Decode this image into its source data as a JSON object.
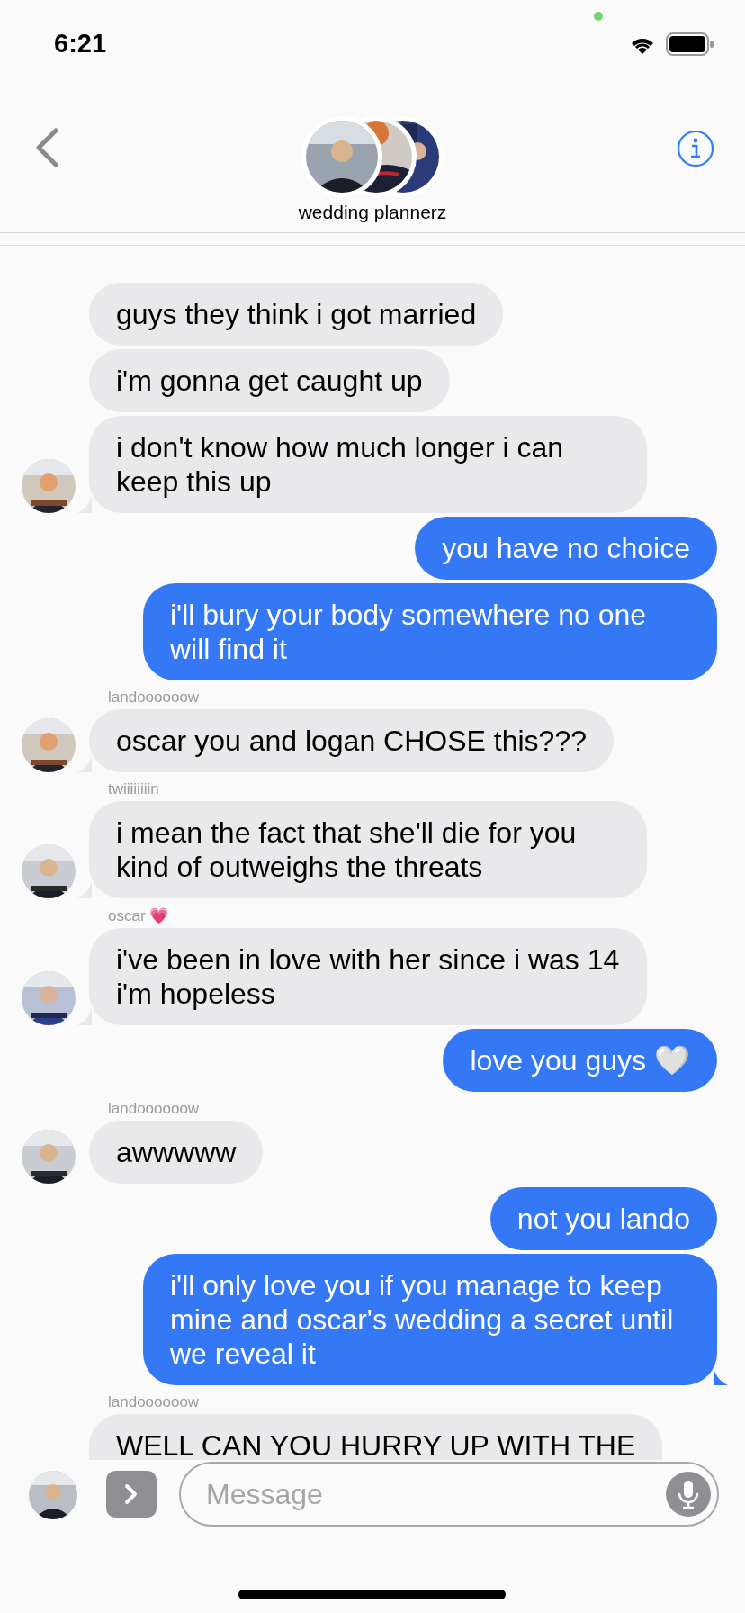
{
  "status_bar": {
    "time": "6:21"
  },
  "header": {
    "title": "wedding plannerz"
  },
  "messages": [
    {
      "kind": "received",
      "text": "guys they think i got married",
      "avatar": false,
      "tail": false
    },
    {
      "kind": "received",
      "text": "i'm gonna get caught up",
      "avatar": false,
      "tail": false
    },
    {
      "kind": "received",
      "text": "i don't know how much longer i can keep this up",
      "avatar": true,
      "tail": true
    },
    {
      "kind": "sent",
      "text": "you have no choice",
      "tail": false
    },
    {
      "kind": "sent",
      "text": "i'll bury your body somewhere no one will find it",
      "tail": false
    },
    {
      "kind": "received",
      "sender": "landoooooow",
      "text": "oscar you and logan CHOSE this???",
      "avatar": true,
      "tail": true
    },
    {
      "kind": "received",
      "sender": "twiiiiiiiin",
      "text": "i mean the fact that she'll die for you kind of outweighs the threats",
      "avatar": true,
      "tail": true
    },
    {
      "kind": "received",
      "sender": "oscar 💗",
      "text": "i've been in love with her since i was 14 i'm hopeless",
      "avatar": true,
      "tail": true
    },
    {
      "kind": "sent",
      "text": "love you guys 🤍",
      "tail": false
    },
    {
      "kind": "received",
      "sender": "landoooooow",
      "text": "awwwww",
      "avatar": true,
      "tail": false
    },
    {
      "kind": "sent",
      "text": "not you lando",
      "tail": false
    },
    {
      "kind": "sent",
      "text": "i'll only love you if you manage to keep mine and oscar's wedding a secret until we reveal it",
      "tail": true
    },
    {
      "kind": "received",
      "sender": "landoooooow",
      "text": "WELL CAN YOU HURRY UP WITH THE"
    }
  ],
  "composer": {
    "placeholder": "Message"
  }
}
